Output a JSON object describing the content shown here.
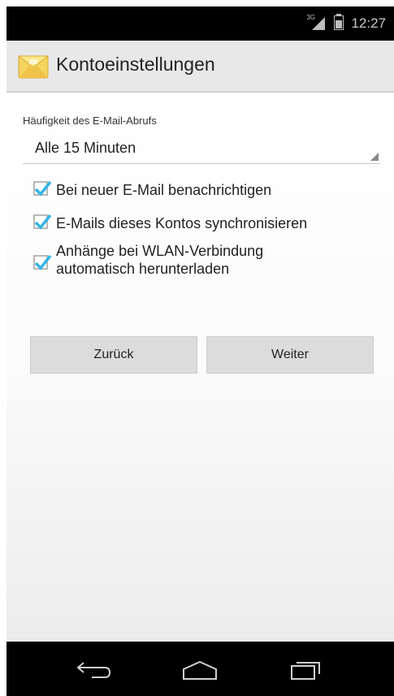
{
  "status_bar": {
    "network": "3G",
    "time": "12:27"
  },
  "action_bar": {
    "title": "Kontoeinstellungen",
    "icon": "email-app-icon"
  },
  "frequency": {
    "label": "Häufigkeit des E-Mail-Abrufs",
    "selected": "Alle 15 Minuten"
  },
  "options": [
    {
      "label": "Bei neuer E-Mail benachrichtigen",
      "checked": true
    },
    {
      "label": "E-Mails dieses Kontos synchronisieren",
      "checked": true
    },
    {
      "label": "Anhänge bei WLAN-Verbindung automatisch herunterladen",
      "checked": true
    }
  ],
  "buttons": {
    "back": "Zurück",
    "next": "Weiter"
  },
  "navigation": {
    "back": "back-icon",
    "home": "home-icon",
    "recents": "recents-icon"
  },
  "colors": {
    "accent": "#33b5e5",
    "status_bar": "#000000",
    "action_bar": "#e8e8e8"
  }
}
